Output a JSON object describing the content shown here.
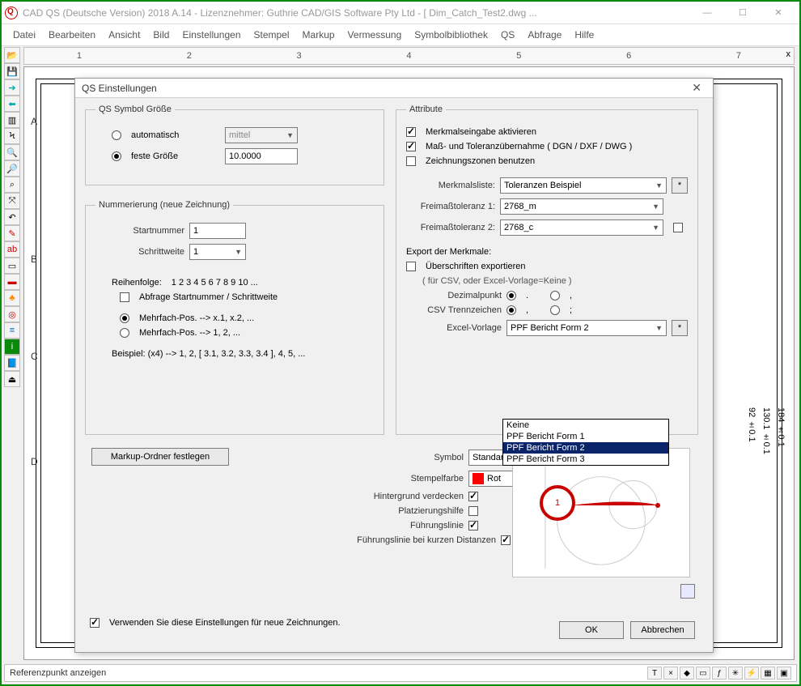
{
  "window": {
    "title": "CAD QS (Deutsche Version) 2018 A.14 - Lizenznehmer: Guthrie CAD/GIS Software Pty Ltd  -  [ Dim_Catch_Test2.dwg ..."
  },
  "menu": [
    "Datei",
    "Bearbeiten",
    "Ansicht",
    "Bild",
    "Einstellungen",
    "Stempel",
    "Markup",
    "Vermessung",
    "Symbolbibliothek",
    "QS",
    "Abfrage",
    "Hilfe"
  ],
  "ruler": [
    "1",
    "2",
    "3",
    "4",
    "5",
    "6",
    "7"
  ],
  "side_letters": [
    "A",
    "B",
    "C",
    "D"
  ],
  "dims": [
    "92 ±0.1",
    "130.1 ±0.1",
    "184 ±0.1"
  ],
  "status": {
    "text": "Referenzpunkt anzeigen"
  },
  "status_icons": [
    "T",
    "×",
    "◆",
    "▭",
    "ƒ",
    "✳",
    "⚡",
    "▦",
    "▣"
  ],
  "dialog": {
    "title": "QS Einstellungen",
    "group_size": {
      "legend": "QS Symbol Größe",
      "opt_auto": "automatisch",
      "opt_fixed": "feste Größe",
      "size_combo": "mittel",
      "size_value": "10.0000"
    },
    "group_num": {
      "legend": "Nummerierung (neue Zeichnung)",
      "start_lbl": "Startnummer",
      "start_val": "1",
      "step_lbl": "Schrittweite",
      "step_val": "1",
      "order_lbl": "Reihenfolge:",
      "order_val": "1  2  3  4  5  6  7  8  9  10 ...",
      "ask_lbl": "Abfrage Startnummer / Schrittweite",
      "multiA": "Mehrfach-Pos. --> x.1, x.2, ...",
      "multiB": "Mehrfach-Pos. --> 1, 2, ...",
      "example_lbl": "Beispiel:  (x4)  -->  1, 2, [ 3.1, 3.2, 3.3, 3.4 ], 4, 5, ..."
    },
    "group_attr": {
      "legend": "Attribute",
      "cb_feature": "Merkmalseingabe aktivieren",
      "cb_tol": "Maß- und Toleranzübernahme ( DGN / DXF / DWG )",
      "cb_zones": "Zeichnungszonen benutzen",
      "merkmal_lbl": "Merkmalsliste:",
      "merkmal_val": "Toleranzen Beispiel",
      "ft1_lbl": "Freimaßtoleranz 1:",
      "ft1_val": "2768_m",
      "ft2_lbl": "Freimaßtoleranz 2:",
      "ft2_val": "2768_c",
      "export_hdr": "Export der Merkmale:",
      "cb_headers": "Überschriften exportieren",
      "headers_sub": "( für CSV, oder Excel-Vorlage=Keine )",
      "dec_lbl": "Dezimalpunkt",
      "dec_a": ".",
      "dec_b": ",",
      "csv_lbl": "CSV Trennzeichen",
      "csv_a": ",",
      "csv_b": ";",
      "excel_lbl": "Excel-Vorlage",
      "excel_val": "PPF Bericht Form 2",
      "excel_opts": [
        "Keine",
        "PPF Bericht Form 1",
        "PPF Bericht Form 2",
        "PPF Bericht Form 3"
      ],
      "star": "*"
    },
    "markup_btn": "Markup-Ordner festlegen",
    "symbol_lbl": "Symbol",
    "symbol_val": "Standard",
    "color_lbl": "Stempelfarbe",
    "color_val": "Rot",
    "color_hex": "#ff0000",
    "cb_hide_bg": "Hintergrund verdecken",
    "cb_place": "Platzierungshilfe",
    "cb_leader": "Führungslinie",
    "cb_leader_short": "Führungslinie bei kurzen Distanzen",
    "cb_use": "Verwenden Sie diese Einstellungen für neue Zeichnungen.",
    "ok": "OK",
    "cancel": "Abbrechen"
  },
  "callout": {
    "num": "1"
  }
}
